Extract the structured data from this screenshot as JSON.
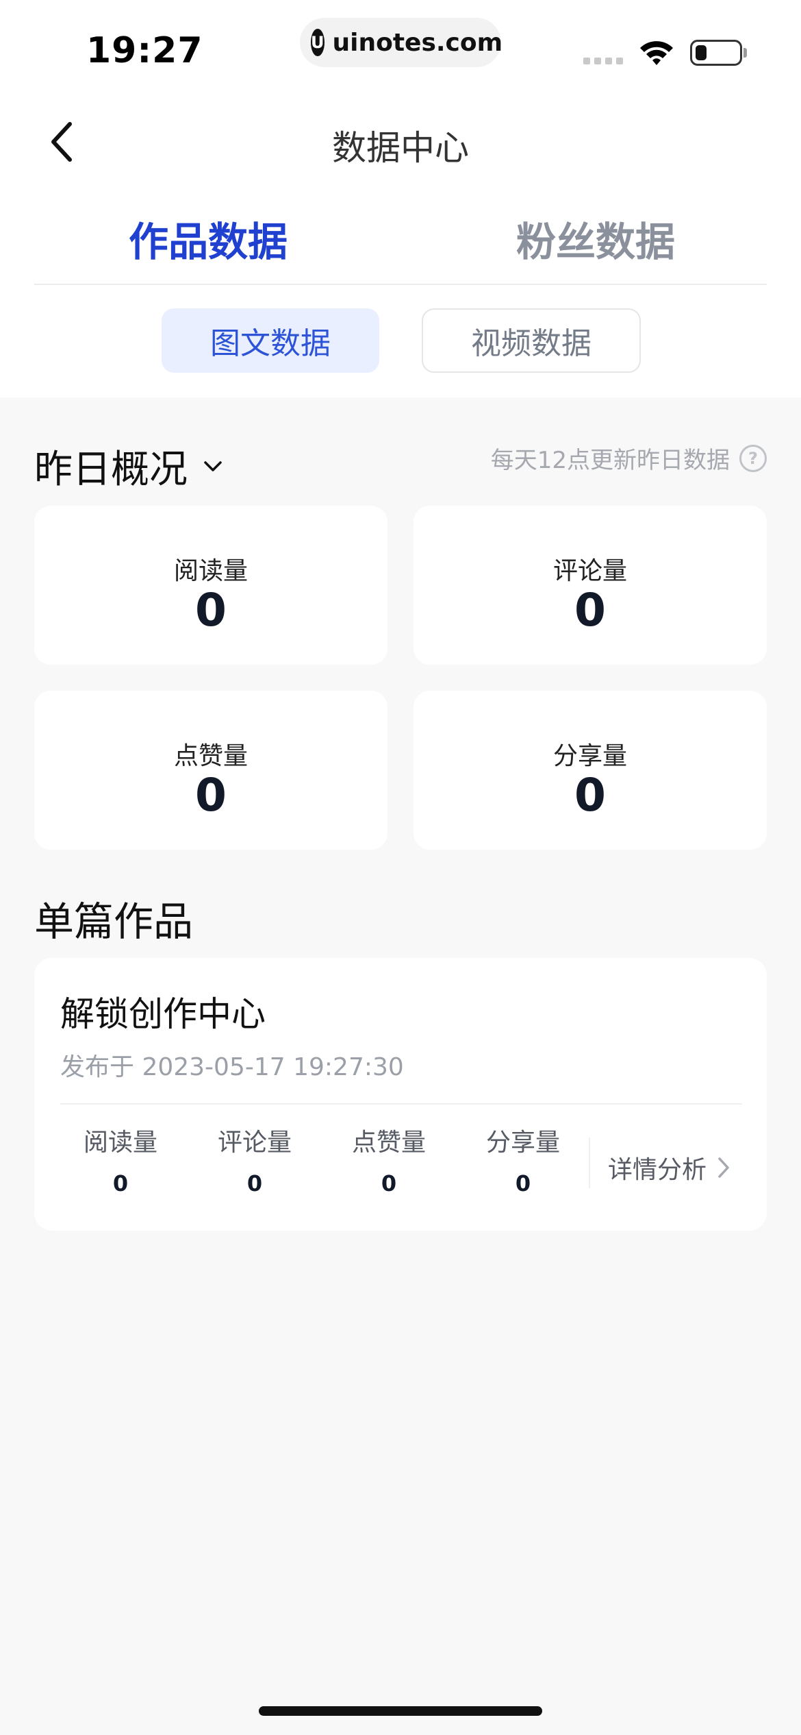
{
  "status_bar": {
    "time": "19:27",
    "url": "uinotes.com"
  },
  "nav": {
    "title": "数据中心"
  },
  "tabs": [
    {
      "label": "作品数据",
      "active": true
    },
    {
      "label": "粉丝数据",
      "active": false
    }
  ],
  "sub_tabs": [
    {
      "label": "图文数据",
      "active": true
    },
    {
      "label": "视频数据",
      "active": false
    }
  ],
  "overview": {
    "title": "昨日概况",
    "update_note": "每天12点更新昨日数据",
    "cards": [
      {
        "label": "阅读量",
        "value": "0"
      },
      {
        "label": "评论量",
        "value": "0"
      },
      {
        "label": "点赞量",
        "value": "0"
      },
      {
        "label": "分享量",
        "value": "0"
      }
    ]
  },
  "works": {
    "title": "单篇作品",
    "items": [
      {
        "name": "解锁创作中心",
        "date": "发布于 2023-05-17 19:27:30",
        "metrics": [
          {
            "label": "阅读量",
            "value": "0"
          },
          {
            "label": "评论量",
            "value": "0"
          },
          {
            "label": "点赞量",
            "value": "0"
          },
          {
            "label": "分享量",
            "value": "0"
          }
        ],
        "detail_label": "详情分析"
      }
    ]
  },
  "colors": {
    "accent": "#2041d0",
    "segment_bg": "#eaefff",
    "page_bg": "#f8f8f8"
  },
  "icons": [
    "back-arrow-icon",
    "chevron-down-icon",
    "help-circle-icon",
    "chevron-right-icon",
    "wifi-icon",
    "battery-icon"
  ]
}
